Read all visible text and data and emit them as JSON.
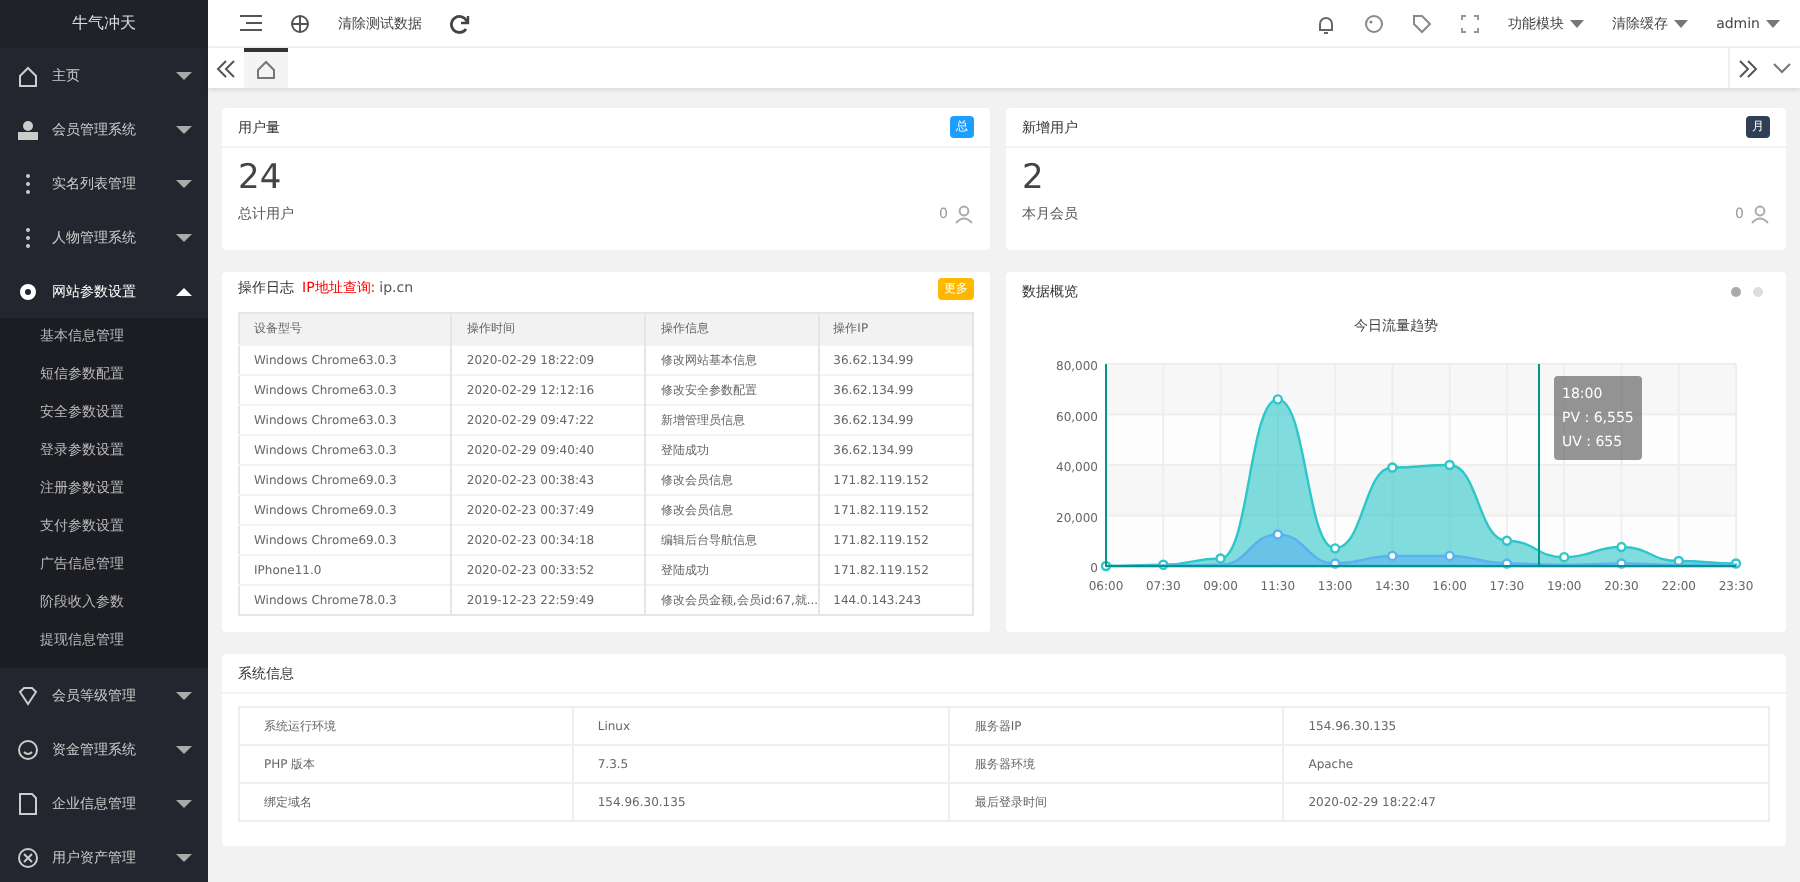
{
  "sidebar": {
    "logo": "牛气冲天",
    "items": [
      {
        "label": "主页",
        "expanded": false
      },
      {
        "label": "会员管理系统",
        "expanded": false
      },
      {
        "label": "实名列表管理",
        "expanded": false
      },
      {
        "label": "人物管理系统",
        "expanded": false
      },
      {
        "label": "网站参数设置",
        "expanded": true,
        "children": [
          "基本信息管理",
          "短信参数配置",
          "安全参数设置",
          "登录参数设置",
          "注册参数设置",
          "支付参数设置",
          "广告信息管理",
          "阶段收入参数",
          "提现信息管理"
        ]
      },
      {
        "label": "会员等级管理",
        "expanded": false
      },
      {
        "label": "资金管理系统",
        "expanded": false
      },
      {
        "label": "企业信息管理",
        "expanded": false
      },
      {
        "label": "用户资产管理",
        "expanded": false
      }
    ]
  },
  "header": {
    "clear_test_data": "清除测试数据",
    "menus": [
      "功能模块",
      "清除缓存",
      "admin"
    ]
  },
  "stats": [
    {
      "title": "用户量",
      "badge": "总",
      "color": "#1e9fff",
      "value": "24",
      "caption": "总计用户",
      "count": "0"
    },
    {
      "title": "新增用户",
      "badge": "月",
      "color": "#2f4056",
      "value": "2",
      "caption": "本月会员",
      "count": "0"
    }
  ],
  "log": {
    "title": "操作日志",
    "link_label": "IP地址查询:",
    "link_site": "ip.cn",
    "badge": "更多",
    "columns": [
      "设备型号",
      "操作时间",
      "操作信息",
      "操作IP"
    ],
    "rows": [
      [
        "Windows Chrome63.0.3",
        "2020-02-29 18:22:09",
        "修改网站基本信息",
        "36.62.134.99"
      ],
      [
        "Windows Chrome63.0.3",
        "2020-02-29 12:12:16",
        "修改安全参数配置",
        "36.62.134.99"
      ],
      [
        "Windows Chrome63.0.3",
        "2020-02-29 09:47:22",
        "新增管理员信息",
        "36.62.134.99"
      ],
      [
        "Windows Chrome63.0.3",
        "2020-02-29 09:40:40",
        "登陆成功",
        "36.62.134.99"
      ],
      [
        "Windows Chrome69.0.3",
        "2020-02-23 00:38:43",
        "修改会员信息",
        "171.82.119.152"
      ],
      [
        "Windows Chrome69.0.3",
        "2020-02-23 00:37:49",
        "修改会员信息",
        "171.82.119.152"
      ],
      [
        "Windows Chrome69.0.3",
        "2020-02-23 00:34:18",
        "编辑后台导航信息",
        "171.82.119.152"
      ],
      [
        "IPhone11.0",
        "2020-02-23 00:33:52",
        "登陆成功",
        "171.82.119.152"
      ],
      [
        "Windows Chrome78.0.3",
        "2019-12-23 22:59:49",
        "修改会员金额,会员id:67,就...",
        "144.0.143.243"
      ]
    ]
  },
  "overview": {
    "title": "数据概览",
    "chart_data": {
      "type": "area",
      "title": "今日流量趋势",
      "grid": true,
      "categories": [
        "06:00",
        "07:30",
        "09:00",
        "11:30",
        "13:00",
        "14:30",
        "16:00",
        "17:30",
        "19:00",
        "20:30",
        "22:00",
        "23:30"
      ],
      "series": [
        {
          "color": "#2ec7c9",
          "values": [
            0,
            500,
            3000,
            66000,
            7000,
            39000,
            40000,
            10000,
            3500,
            7500,
            2000,
            1000
          ]
        },
        {
          "color": "#5ab1ef",
          "values": [
            0,
            200,
            500,
            12500,
            1000,
            4000,
            4000,
            1000,
            500,
            1000,
            500,
            500
          ]
        }
      ],
      "ylim": [
        0,
        80000
      ],
      "yticks": [
        {
          "value": 0,
          "label": "0"
        },
        {
          "value": 20000,
          "label": "20,000"
        },
        {
          "value": 40000,
          "label": "40,000"
        },
        {
          "value": 60000,
          "label": "60,000"
        },
        {
          "value": 80000,
          "label": "80,000"
        }
      ]
    },
    "tooltip": [
      "18:00",
      "PV : 6,555",
      "UV : 655"
    ]
  },
  "sysinfo": {
    "title": "系统信息",
    "rows": [
      [
        "系统运行环境",
        "Linux",
        "服务器IP",
        "154.96.30.135"
      ],
      [
        "PHP 版本",
        "7.3.5",
        "服务器环境",
        "Apache"
      ],
      [
        "绑定域名",
        "154.96.30.135",
        "最后登录时间",
        "2020-02-29 18:22:47"
      ]
    ]
  }
}
